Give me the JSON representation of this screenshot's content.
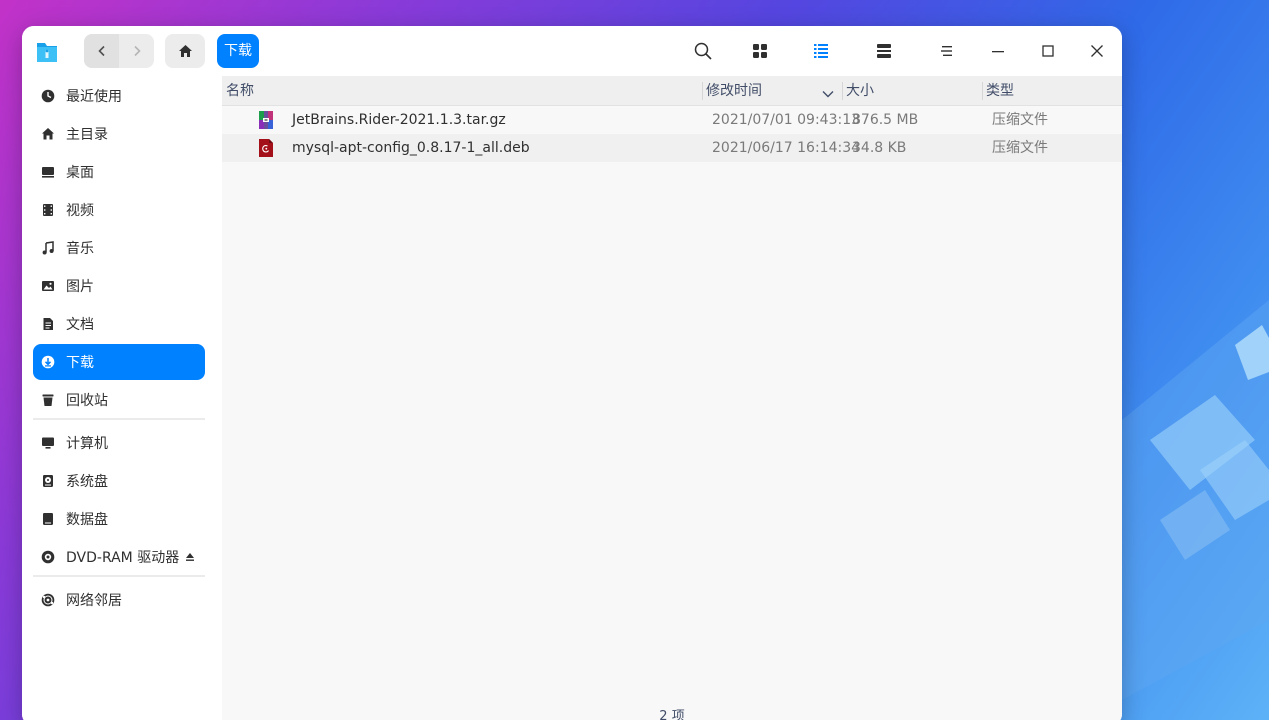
{
  "window": {
    "breadcrumb": "下载",
    "toolbar_icons": [
      "search-icon",
      "grid-view-icon",
      "list-view-icon",
      "detail-view-icon",
      "menu-icon",
      "minimize-icon",
      "maximize-icon",
      "close-icon"
    ]
  },
  "sidebar": {
    "items": [
      {
        "label": "最近使用",
        "icon": "clock-icon"
      },
      {
        "label": "主目录",
        "icon": "home-icon"
      },
      {
        "label": "桌面",
        "icon": "desktop-icon"
      },
      {
        "label": "视频",
        "icon": "video-icon"
      },
      {
        "label": "音乐",
        "icon": "music-icon"
      },
      {
        "label": "图片",
        "icon": "picture-icon"
      },
      {
        "label": "文档",
        "icon": "document-icon"
      },
      {
        "label": "下载",
        "icon": "download-icon",
        "active": true
      },
      {
        "label": "回收站",
        "icon": "trash-icon"
      },
      {
        "label": "计算机",
        "icon": "computer-icon"
      },
      {
        "label": "系统盘",
        "icon": "system-disk-icon"
      },
      {
        "label": "数据盘",
        "icon": "data-disk-icon"
      },
      {
        "label": "DVD-RAM 驱动器",
        "icon": "optical-drive-icon"
      },
      {
        "label": "网络邻居",
        "icon": "network-icon"
      }
    ]
  },
  "table": {
    "columns": [
      "名称",
      "修改时间",
      "大小",
      "类型"
    ],
    "rows": [
      {
        "name": "JetBrains.Rider-2021.1.3.tar.gz",
        "modified": "2021/07/01 09:43:13",
        "size": "876.5 MB",
        "type": "压缩文件",
        "icon": "archive-file-icon"
      },
      {
        "name": "mysql-apt-config_0.8.17-1_all.deb",
        "modified": "2021/06/17 16:14:34",
        "size": "34.8 KB",
        "type": "压缩文件",
        "icon": "deb-package-icon"
      }
    ]
  },
  "status": {
    "count": "2 项"
  },
  "colors": {
    "accent": "#0081ff",
    "sidebar_bg": "#ffffff",
    "content_bg": "#f8f8f8"
  }
}
